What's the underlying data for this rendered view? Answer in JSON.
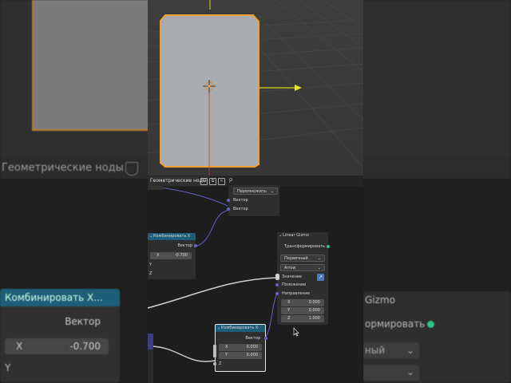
{
  "background": {
    "header_title": "Геометрические ноды",
    "combine_node": {
      "title": "Комбинировать X...",
      "output_label": "Вектор",
      "x_field": {
        "key": "X",
        "value": "-0.700"
      },
      "y_label": "Y"
    },
    "gizmo_node": {
      "title_partial": "Gizmo",
      "transform_partial": "ормировать",
      "dropdown_partial": "ный"
    }
  },
  "node_editor": {
    "header": {
      "title": "Геометрические ноды",
      "icons": [
        "shield-icon",
        "copy-icon",
        "close-icon",
        "pin-icon"
      ]
    },
    "multiply_node": {
      "operation": "Перемножить",
      "inputs": [
        "Вектор",
        "Вектор"
      ]
    },
    "combine_node_1": {
      "title": "Комбинировать X",
      "output": "Вектор",
      "x": {
        "key": "X",
        "value": "-0.700"
      },
      "y_label": "Y",
      "z_label": "Z"
    },
    "gizmo_node": {
      "title": "Linear Gizmo",
      "output": "Трансформировать",
      "color_mode": "Первичный",
      "draw_style": "Arrow",
      "inputs": [
        "Значение",
        "Положение",
        "Направление"
      ],
      "direction": [
        {
          "key": "X",
          "value": "0.000"
        },
        {
          "key": "Y",
          "value": "0.000"
        },
        {
          "key": "Z",
          "value": "1.000"
        }
      ]
    },
    "combine_node_2": {
      "title": "Комбинировать X",
      "output": "Вектор",
      "fields": [
        {
          "key": "X",
          "value": "0.000"
        },
        {
          "key": "Y",
          "value": "0.000"
        }
      ],
      "z_label": "Z"
    }
  },
  "colors": {
    "vector_socket": "#6363c7",
    "geometry_socket": "#2ec58b",
    "combine_header": "#1f5e78",
    "selection_outline": "#f0a030",
    "gizmo_arrow": "#e7e31f"
  }
}
